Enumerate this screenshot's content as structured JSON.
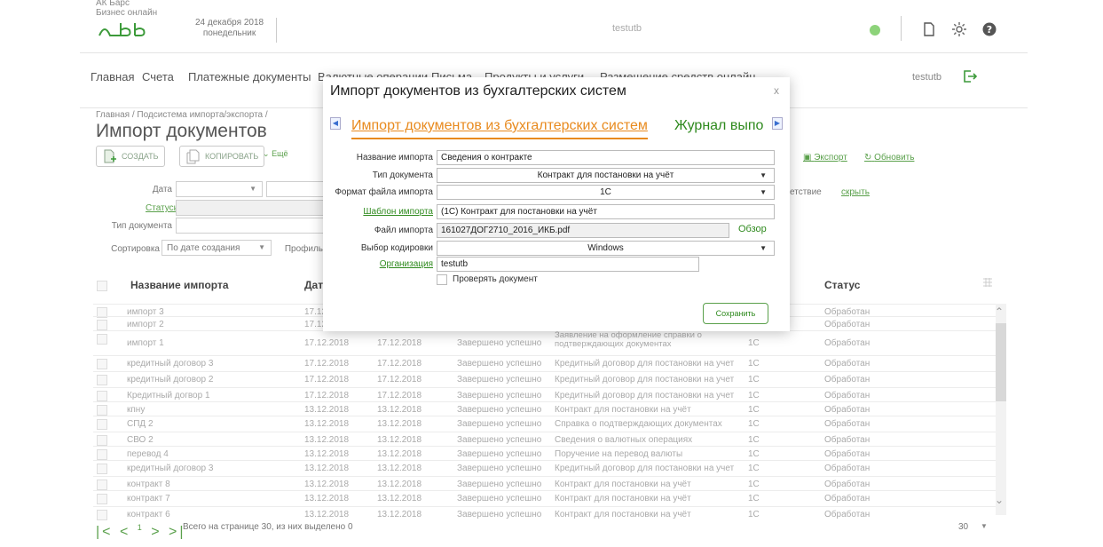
{
  "header": {
    "brand_line1": "АК Барс",
    "brand_line2": "Бизнес онлайн",
    "date": "24 декабря 2018",
    "weekday": "понедельник",
    "user_center": "testutb",
    "status_color": "#8dd37a"
  },
  "nav": {
    "items": [
      "Главная",
      "Счета",
      "Платежные документы",
      "Валютные операции",
      "Письма",
      "Продукты и услуги",
      "Размещение средств онлайн"
    ],
    "user": "testutb"
  },
  "page": {
    "breadcrumb": "Главная / Подсистема импорта/экспорта /",
    "title": "Импорт документов",
    "create_label": "СОЗДАТЬ",
    "copy_label": "КОПИРОВАТЬ",
    "more_label": "Ещё",
    "export_label": "Экспорт",
    "refresh_label": "Обновить"
  },
  "filters": {
    "date_label": "Дата",
    "statuses_label": "Статусы",
    "doctype_label": "Тип документа",
    "sort_label": "Сортировка",
    "sort_value": "По дате создания",
    "profile_label": "Профиль",
    "match_label": "етствие",
    "hide_label": "скрыть"
  },
  "table": {
    "columns": [
      "Название импорта",
      "Дата",
      "Статус"
    ],
    "rows": [
      {
        "name": "импорт 3",
        "date1": "17.12",
        "date2": "",
        "result": "",
        "doc": "",
        "format": "",
        "status": "Обработан"
      },
      {
        "name": "импорт 2",
        "date1": "17.12",
        "date2": "",
        "result": "",
        "doc": "",
        "format": "",
        "status": "Обработан"
      },
      {
        "name": "импорт 1",
        "date1": "17.12.2018",
        "date2": "17.12.2018",
        "result": "Завершено успешно",
        "doc": "Заявление на оформление справки о подтверждающих документах",
        "format": "1C",
        "status": "Обработан"
      },
      {
        "name": "кредитный договор 3",
        "date1": "17.12.2018",
        "date2": "17.12.2018",
        "result": "Завершено успешно",
        "doc": "Кредитный договор для постановки на учет",
        "format": "1C",
        "status": "Обработан"
      },
      {
        "name": "кредитный договор 2",
        "date1": "17.12.2018",
        "date2": "17.12.2018",
        "result": "Завершено успешно",
        "doc": "Кредитный договор для постановки на учет",
        "format": "1C",
        "status": "Обработан"
      },
      {
        "name": "Кредитный догвор 1",
        "date1": "17.12.2018",
        "date2": "17.12.2018",
        "result": "Завершено успешно",
        "doc": "Кредитный договор для постановки на учет",
        "format": "1C",
        "status": "Обработан"
      },
      {
        "name": "кпну",
        "date1": "13.12.2018",
        "date2": "13.12.2018",
        "result": "Завершено успешно",
        "doc": "Контракт для постановки на учёт",
        "format": "1C",
        "status": "Обработан"
      },
      {
        "name": "СПД 2",
        "date1": "13.12.2018",
        "date2": "13.12.2018",
        "result": "Завершено успешно",
        "doc": "Справка о подтверждающих документах",
        "format": "1C",
        "status": "Обработан"
      },
      {
        "name": "СВО 2",
        "date1": "13.12.2018",
        "date2": "13.12.2018",
        "result": "Завершено успешно",
        "doc": "Сведения о валютных операциях",
        "format": "1C",
        "status": "Обработан"
      },
      {
        "name": "перевод 4",
        "date1": "13.12.2018",
        "date2": "13.12.2018",
        "result": "Завершено успешно",
        "doc": "Поручение на перевод валюты",
        "format": "1C",
        "status": "Обработан"
      },
      {
        "name": "кредитный договор 3",
        "date1": "13.12.2018",
        "date2": "13.12.2018",
        "result": "Завершено успешно",
        "doc": "Кредитный договор для постановки на учет",
        "format": "1C",
        "status": "Обработан"
      },
      {
        "name": "контракт 8",
        "date1": "13.12.2018",
        "date2": "13.12.2018",
        "result": "Завершено успешно",
        "doc": "Контракт для постановки на учёт",
        "format": "1C",
        "status": "Обработан"
      },
      {
        "name": "контракт 7",
        "date1": "13.12.2018",
        "date2": "13.12.2018",
        "result": "Завершено успешно",
        "doc": "Контракт для постановки на учёт",
        "format": "1C",
        "status": "Обработан"
      },
      {
        "name": "контракт 6",
        "date1": "13.12.2018",
        "date2": "13.12.2018",
        "result": "Завершено успешно",
        "doc": "Контракт для постановки на учёт",
        "format": "1C",
        "status": "Обработан"
      }
    ]
  },
  "footer": {
    "page_current": "1",
    "info": "Всего на странице 30, из них выделено 0",
    "page_size": "30"
  },
  "modal": {
    "title": "Импорт документов из бухгалтерских систем",
    "close": "x",
    "tab_active": "Импорт документов из бухгалтерских систем",
    "tab_other": "Журнал выпо",
    "name_label": "Название импорта",
    "name_value": "Сведения о контракте",
    "doctype_label": "Тип документа",
    "doctype_value": "Контракт для постановки на учёт",
    "format_label": "Формат файла импорта",
    "format_value": "1C",
    "template_label": "Шаблон импорта",
    "template_value": "(1С) Контракт для постановки на учёт",
    "file_label": "Файл импорта",
    "file_value": "161027ДОГ2710_2016_ИКБ.pdf",
    "browse_label": "Обзор",
    "encoding_label": "Выбор кодировки",
    "encoding_value": "Windows",
    "org_label": "Организация",
    "org_value": "testutb",
    "check_label": "Проверять документ",
    "save_label": "Сохранить",
    "accent_color": "#e88a1e",
    "link_color": "#2f8a1e"
  }
}
